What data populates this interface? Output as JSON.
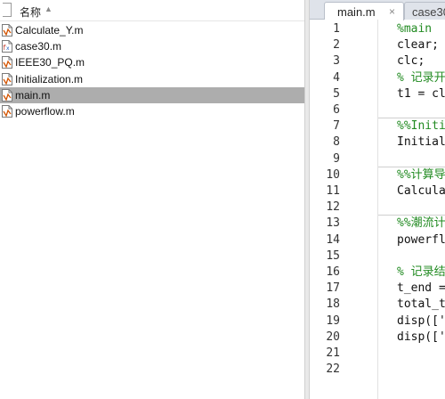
{
  "file_browser": {
    "header_label": "名称",
    "sort_indicator": "▲",
    "files": [
      {
        "name": "Calculate_Y.m",
        "icon": "matlab-script-icon",
        "selected": false
      },
      {
        "name": "case30.m",
        "icon": "matlab-function-icon",
        "selected": false
      },
      {
        "name": "IEEE30_PQ.m",
        "icon": "matlab-script-icon",
        "selected": false
      },
      {
        "name": "Initialization.m",
        "icon": "matlab-script-icon",
        "selected": false
      },
      {
        "name": "main.m",
        "icon": "matlab-script-icon",
        "selected": true
      },
      {
        "name": "powerflow.m",
        "icon": "matlab-script-icon",
        "selected": false
      }
    ]
  },
  "editor": {
    "tabs": [
      {
        "label": "main.m",
        "active": true
      },
      {
        "label": "case30",
        "active": false
      }
    ],
    "tab_close_glyph": "×",
    "lines": [
      {
        "n": "1",
        "text": "%main",
        "kind": "comment"
      },
      {
        "n": "2",
        "text": "clear;",
        "kind": "code"
      },
      {
        "n": "3",
        "text": "clc;",
        "kind": "code"
      },
      {
        "n": "4",
        "text": "% 记录开",
        "kind": "comment"
      },
      {
        "n": "5",
        "text": "t1 = cl",
        "kind": "code"
      },
      {
        "n": "6",
        "text": "",
        "kind": "code"
      },
      {
        "n": "7",
        "text": "%%Initi",
        "kind": "cell"
      },
      {
        "n": "8",
        "text": "Initial",
        "kind": "code"
      },
      {
        "n": "9",
        "text": "",
        "kind": "code"
      },
      {
        "n": "10",
        "text": "%%计算导",
        "kind": "cell"
      },
      {
        "n": "11",
        "text": "Calcula",
        "kind": "code"
      },
      {
        "n": "12",
        "text": "",
        "kind": "code"
      },
      {
        "n": "13",
        "text": "%%潮流计",
        "kind": "cell"
      },
      {
        "n": "14",
        "text": "powerfl",
        "kind": "code"
      },
      {
        "n": "15",
        "text": "",
        "kind": "code"
      },
      {
        "n": "16",
        "text": "% 记录结",
        "kind": "comment"
      },
      {
        "n": "17",
        "text": "t_end =",
        "kind": "code"
      },
      {
        "n": "18",
        "text": "total_t",
        "kind": "code"
      },
      {
        "n": "19",
        "text": "disp(['",
        "kind": "code"
      },
      {
        "n": "20",
        "text": "disp(['",
        "kind": "code"
      },
      {
        "n": "21",
        "text": "",
        "kind": "code"
      },
      {
        "n": "22",
        "text": "",
        "kind": "code"
      }
    ]
  },
  "colors": {
    "selection": "#adadad",
    "comment": "#228b22",
    "tab_strip": "#dfe3ea"
  }
}
